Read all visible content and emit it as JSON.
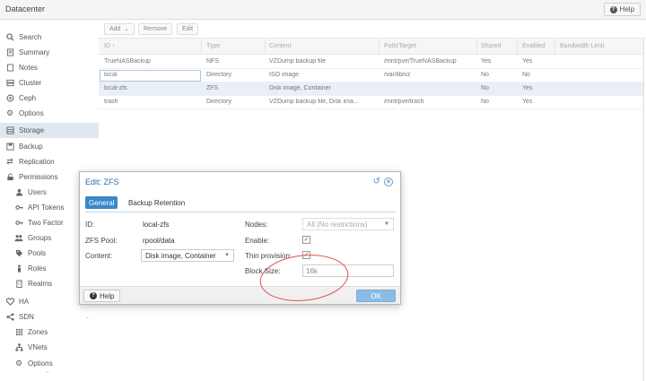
{
  "header": {
    "title": "Datacenter",
    "help_label": "Help"
  },
  "sidebar": {
    "items": [
      {
        "label": "Search",
        "icon": "search-icon"
      },
      {
        "label": "Summary",
        "icon": "book-icon"
      },
      {
        "label": "Notes",
        "icon": "notes-icon"
      },
      {
        "label": "Cluster",
        "icon": "server-icon"
      },
      {
        "label": "Ceph",
        "icon": "ceph-icon"
      },
      {
        "label": "Options",
        "icon": "gear-icon"
      },
      {
        "label": "Storage",
        "icon": "database-icon"
      },
      {
        "label": "Backup",
        "icon": "floppy-icon"
      },
      {
        "label": "Replication",
        "icon": "retweet-icon"
      },
      {
        "label": "Permissions",
        "icon": "unlock-icon"
      },
      {
        "label": "Users",
        "icon": "user-icon"
      },
      {
        "label": "API Tokens",
        "icon": "key-icon"
      },
      {
        "label": "Two Factor",
        "icon": "key-icon"
      },
      {
        "label": "Groups",
        "icon": "users-icon"
      },
      {
        "label": "Pools",
        "icon": "tags-icon"
      },
      {
        "label": "Roles",
        "icon": "male-icon"
      },
      {
        "label": "Realms",
        "icon": "building-icon"
      },
      {
        "label": "HA",
        "icon": "heartbeat-icon"
      },
      {
        "label": "SDN",
        "icon": "sdn-icon"
      },
      {
        "label": "Zones",
        "icon": "th-icon"
      },
      {
        "label": "VNets",
        "icon": "network-icon"
      },
      {
        "label": "Options",
        "icon": "gear-icon"
      }
    ],
    "active": "Storage"
  },
  "toolbar": {
    "add_label": "Add",
    "remove_label": "Remove",
    "edit_label": "Edit"
  },
  "grid": {
    "columns": [
      "ID ↑",
      "Type",
      "Content",
      "Path/Target",
      "Shared",
      "Enabled",
      "Bandwidth Limit"
    ],
    "rows": [
      [
        "TrueNASBackup",
        "NFS",
        "VZDump backup file",
        "/mnt/pve/TrueNASBackup",
        "Yes",
        "Yes"
      ],
      [
        "local",
        "Directory",
        "ISO image",
        "/var/lib/vz",
        "No",
        "No"
      ],
      [
        "local-zfs",
        "ZFS",
        "Disk image, Container",
        "",
        "No",
        "Yes"
      ],
      [
        "trash",
        "Directory",
        "VZDump backup file, Disk ima...",
        "/mnt/pve/trash",
        "No",
        "Yes"
      ]
    ]
  },
  "dialog": {
    "title": "Edit: ZFS",
    "tabs": [
      "General",
      "Backup Retention"
    ],
    "fields": {
      "id_label": "ID:",
      "id_value": "local-zfs",
      "pool_label": "ZFS Pool:",
      "pool_value": "rpool/data",
      "content_label": "Content:",
      "content_value": "Disk image, Container",
      "nodes_label": "Nodes:",
      "nodes_value": "All (No restrictions)",
      "enable_label": "Enable:",
      "thin_label": "Thin provision:",
      "block_label": "Block Size:",
      "block_value": "16k"
    },
    "help_label": "Help",
    "ok_label": "OK"
  },
  "colors": {
    "accent": "#3a87c8",
    "annotation": "#d9534f"
  }
}
